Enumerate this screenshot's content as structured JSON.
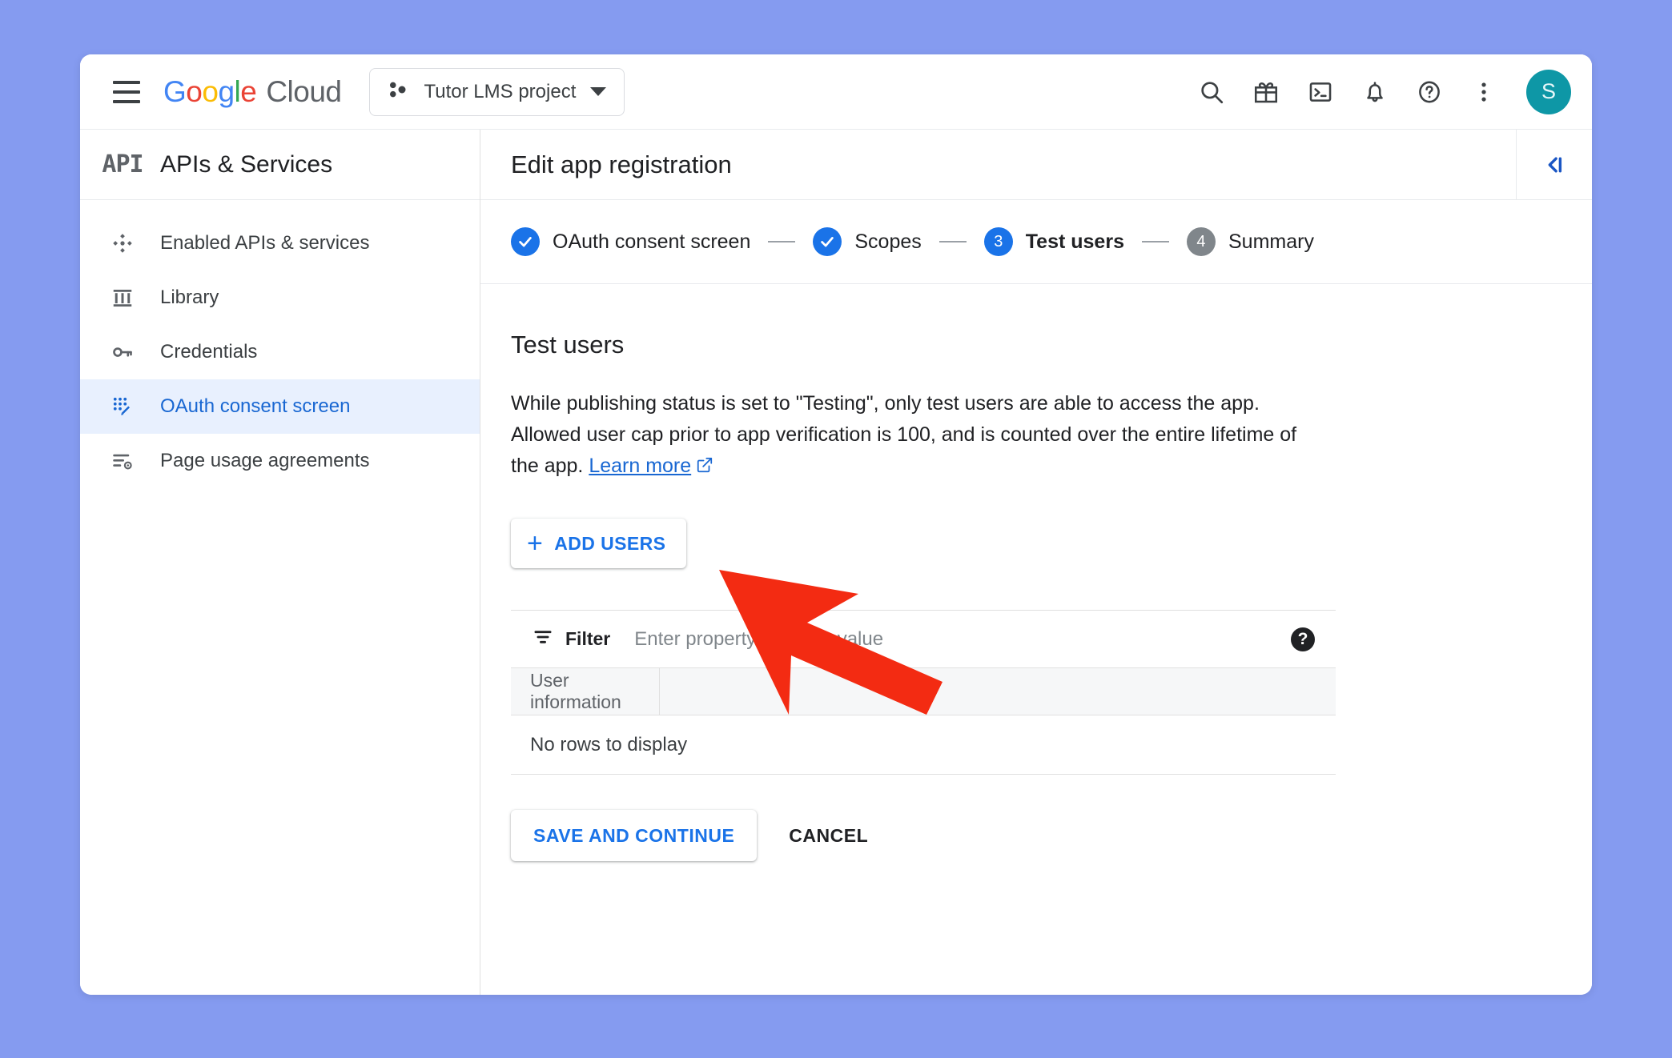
{
  "colors": {
    "page_background": "#859BF0",
    "accent_blue": "#1A73E8",
    "link_blue": "#1967D2",
    "avatar_teal": "#0E97A6",
    "annotation_red": "#F32B12",
    "step_future_gray": "#80868B",
    "selected_nav_bg": "#E8F0FE"
  },
  "topbar": {
    "menu_icon": "hamburger-menu-icon",
    "logo": {
      "google": [
        "G",
        "o",
        "o",
        "g",
        "l",
        "e"
      ],
      "cloud": "Cloud"
    },
    "project_chip": {
      "icon": "project-nodes-icon",
      "label": "Tutor LMS project",
      "caret": "chevron-down-icon"
    },
    "icons": [
      {
        "name": "search-icon",
        "title": "Search"
      },
      {
        "name": "gift-icon",
        "title": "Gift"
      },
      {
        "name": "cloud-shell-icon",
        "title": "Activate Cloud Shell"
      },
      {
        "name": "notifications-bell-icon",
        "title": "Notifications"
      },
      {
        "name": "help-circle-icon",
        "title": "Help"
      },
      {
        "name": "more-vert-icon",
        "title": "More options"
      }
    ],
    "avatar_initial": "S"
  },
  "sidebar": {
    "product_glyph": "API",
    "title": "APIs & Services",
    "items": [
      {
        "label": "Enabled APIs & services",
        "icon": "enabled-apis-icon",
        "active": false
      },
      {
        "label": "Library",
        "icon": "library-icon",
        "active": false
      },
      {
        "label": "Credentials",
        "icon": "key-icon",
        "active": false
      },
      {
        "label": "OAuth consent screen",
        "icon": "oauth-consent-icon",
        "active": true
      },
      {
        "label": "Page usage agreements",
        "icon": "page-usage-agreements-icon",
        "active": false
      }
    ]
  },
  "content": {
    "header_title": "Edit app registration",
    "collapse_icon": "collapse-panel-icon",
    "stepper": [
      {
        "number": "1",
        "label": "OAuth consent screen",
        "state": "done"
      },
      {
        "number": "2",
        "label": "Scopes",
        "state": "done"
      },
      {
        "number": "3",
        "label": "Test users",
        "state": "current"
      },
      {
        "number": "4",
        "label": "Summary",
        "state": "future"
      }
    ],
    "section_title": "Test users",
    "description": "While publishing status is set to \"Testing\", only test users are able to access the app. Allowed user cap prior to app verification is 100, and is counted over the entire lifetime of the app.",
    "learn_more": "Learn more",
    "learn_more_icon": "open-in-new-icon",
    "add_users_button": "ADD USERS",
    "add_users_icon": "plus-icon",
    "filter": {
      "icon": "filter-list-icon",
      "label": "Filter",
      "placeholder": "Enter property name or value",
      "value": "",
      "help_icon": "help-filled-icon",
      "help_glyph": "?"
    },
    "table": {
      "columns": [
        "User information",
        ""
      ],
      "empty_message": "No rows to display"
    },
    "footer": {
      "save_label": "SAVE AND CONTINUE",
      "cancel_label": "CANCEL"
    }
  },
  "annotation": {
    "type": "arrow",
    "color": "#F32B12",
    "points_to": "add-users-button"
  }
}
